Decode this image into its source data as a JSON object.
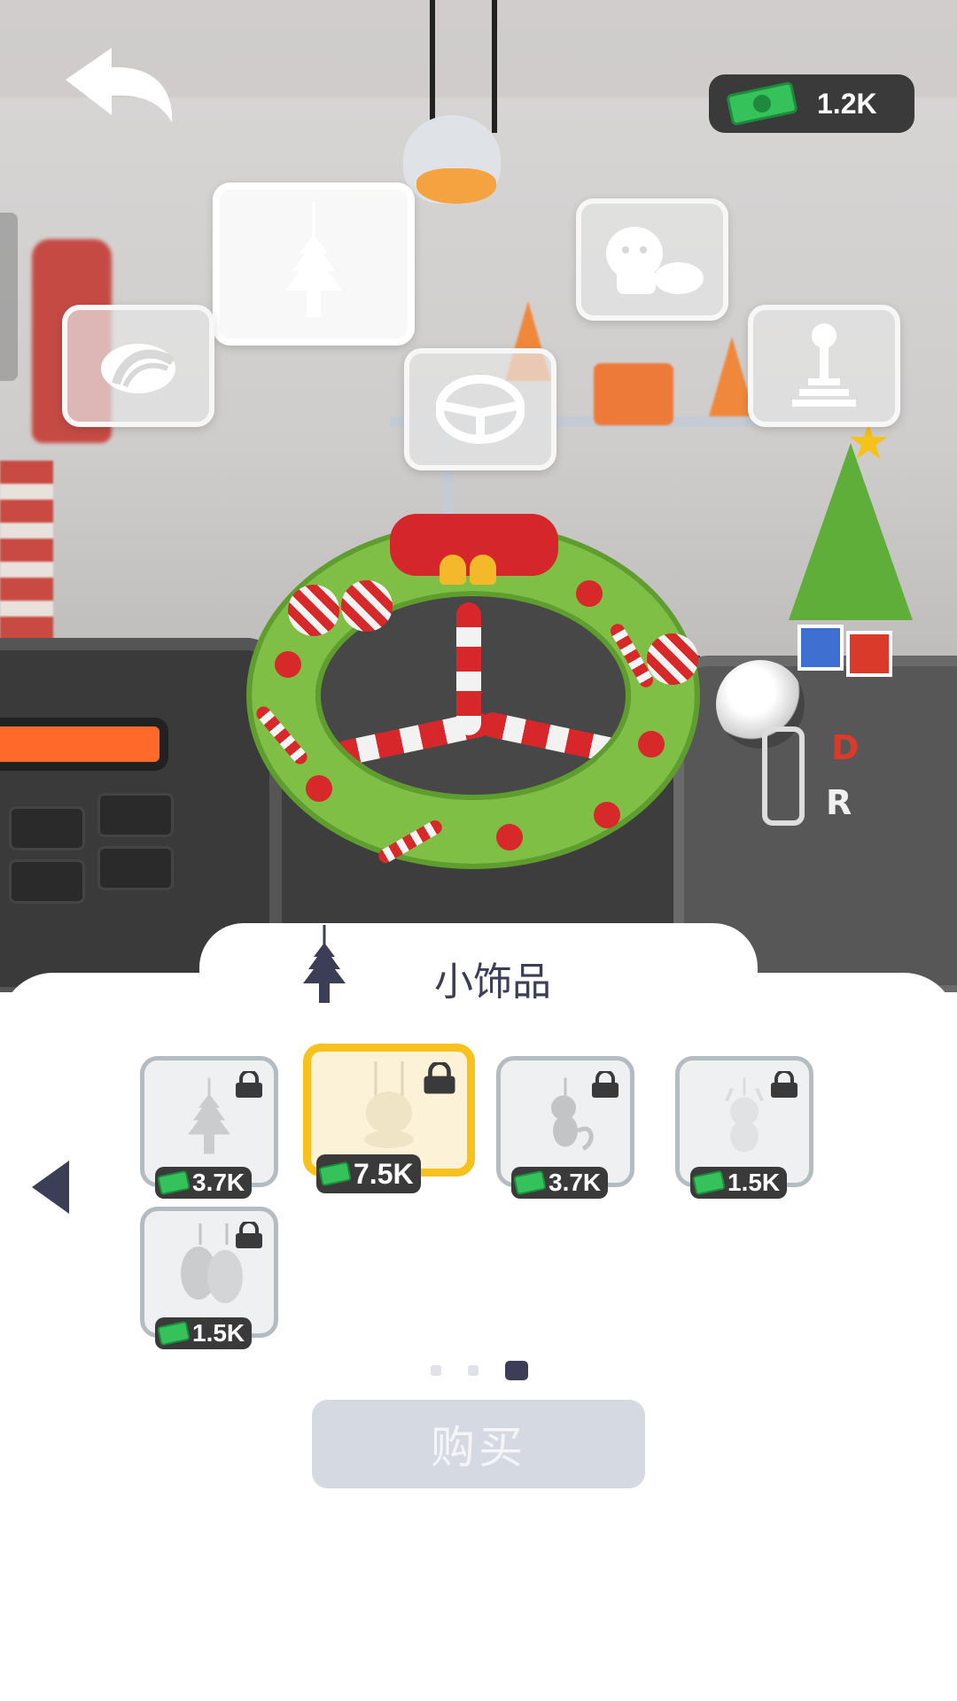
{
  "hud": {
    "currency_amount": "1.2K",
    "icons": {
      "back": "back-arrow-icon",
      "currency": "cash-bill-icon"
    }
  },
  "categories": [
    {
      "name": "air-freshener",
      "icon": "air-freshener-icon",
      "selected": true
    },
    {
      "name": "decal",
      "icon": "sticker-icon",
      "selected": false
    },
    {
      "name": "steering-wheel",
      "icon": "steering-wheel-icon",
      "selected": false
    },
    {
      "name": "dashboard-pet",
      "icon": "dog-toy-icon",
      "selected": false
    },
    {
      "name": "gear-shifter",
      "icon": "gear-shifter-icon",
      "selected": false
    }
  ],
  "scene": {
    "gear_labels": [
      "D",
      "R"
    ]
  },
  "panel": {
    "title": "小饰品",
    "title_icon": "air-freshener-icon",
    "items": [
      {
        "price": "3.7K",
        "icon": "tree-freshener-icon",
        "locked": true,
        "selected": false
      },
      {
        "price": "7.5K",
        "icon": "duck-toy-icon",
        "locked": true,
        "selected": true
      },
      {
        "price": "3.7K",
        "icon": "monkey-toy-icon",
        "locked": true,
        "selected": false
      },
      {
        "price": "1.5K",
        "icon": "reindeer-toy-icon",
        "locked": true,
        "selected": false
      },
      {
        "price": "1.5K",
        "icon": "boxing-gloves-icon",
        "locked": true,
        "selected": false
      }
    ],
    "pagination": {
      "pages": 3,
      "current": 3
    },
    "buy_label": "购买"
  },
  "colors": {
    "accent": "#3c3e58",
    "selected_border": "#f7c21e",
    "currency_green": "#35c25a",
    "buy_disabled": "#d5d9e1"
  }
}
